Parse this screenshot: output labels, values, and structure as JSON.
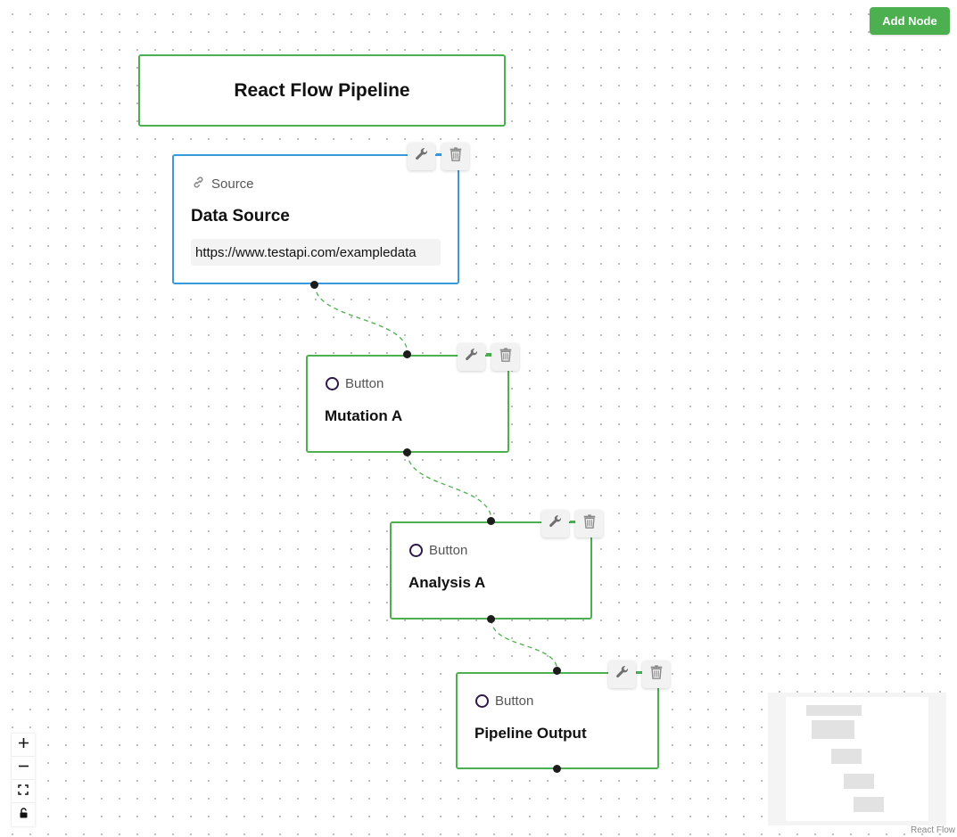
{
  "toolbar": {
    "add_node_label": "Add Node"
  },
  "title_node": {
    "label": "React Flow Pipeline"
  },
  "nodes": [
    {
      "type_label": "Source",
      "type_icon": "link-icon",
      "title": "Data Source",
      "url_value": "https://www.testapi.com/exampledata",
      "border_color": "#3a98dc"
    },
    {
      "type_label": "Button",
      "type_icon": "circle-icon",
      "title": "Mutation A",
      "border_color": "#4caf50"
    },
    {
      "type_label": "Button",
      "type_icon": "circle-icon",
      "title": "Analysis A",
      "border_color": "#4caf50"
    },
    {
      "type_label": "Button",
      "type_icon": "circle-icon",
      "title": "Pipeline Output",
      "border_color": "#4caf50"
    }
  ],
  "node_tools": {
    "settings_icon": "wrench-icon",
    "delete_icon": "trash-icon"
  },
  "controls": {
    "zoom_in_icon": "plus-icon",
    "zoom_out_icon": "minus-icon",
    "fit_view_icon": "fit-view-icon",
    "lock_icon": "lock-icon"
  },
  "attribution": "React Flow",
  "colors": {
    "accent": "#4caf50",
    "source_border": "#3a98dc",
    "edge": "#4caf50"
  }
}
